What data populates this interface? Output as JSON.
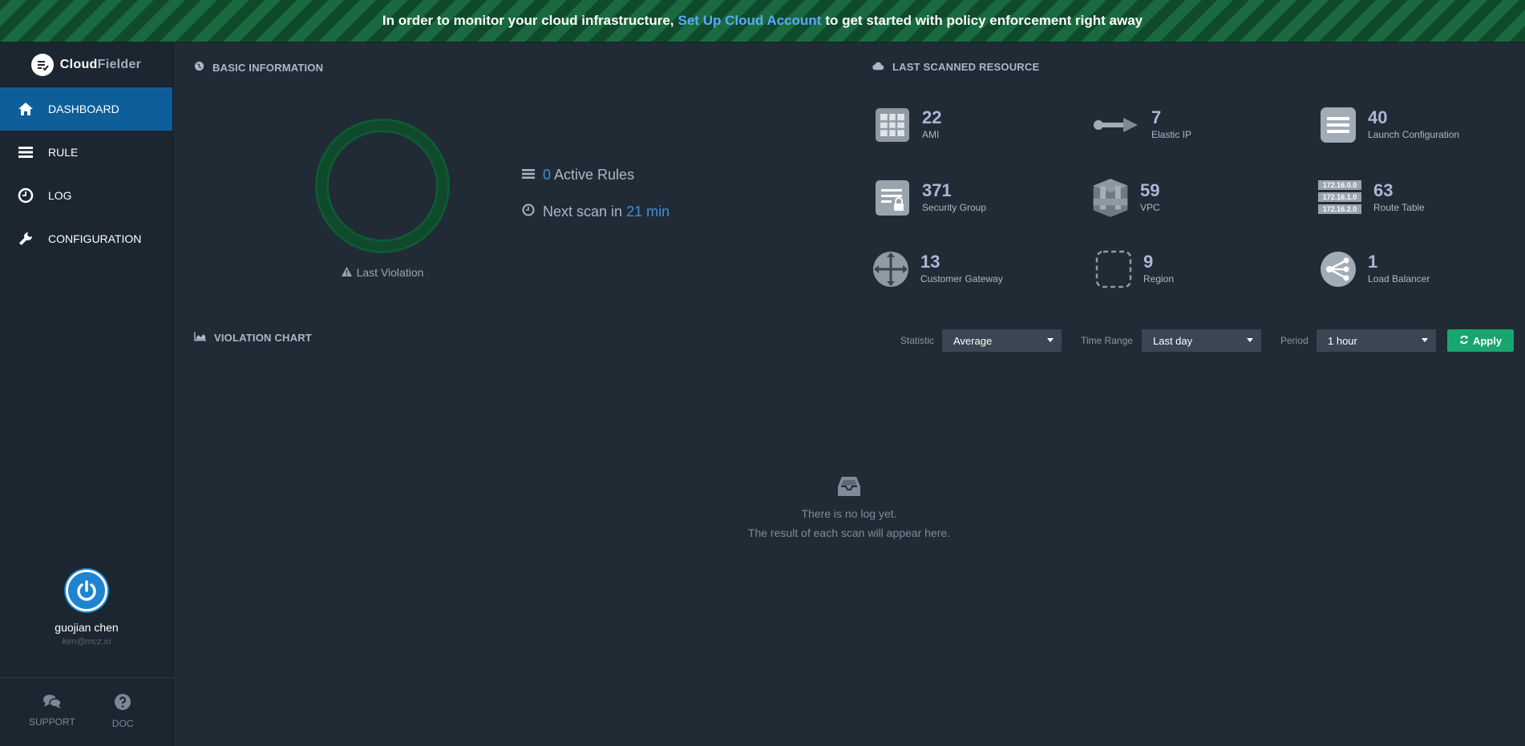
{
  "banner": {
    "prefix": "In order to monitor your cloud infrastructure,",
    "link": "Set Up Cloud Account",
    "suffix": "to get started with policy enforcement right away"
  },
  "brand": {
    "name_part1": "Cloud",
    "name_part2": "Fielder"
  },
  "sidebar": {
    "items": [
      {
        "label": "DASHBOARD",
        "icon": "home-icon",
        "active": true
      },
      {
        "label": "RULE",
        "icon": "list-icon",
        "active": false
      },
      {
        "label": "LOG",
        "icon": "clock-icon",
        "active": false
      },
      {
        "label": "CONFIGURATION",
        "icon": "wrench-icon",
        "active": false
      }
    ],
    "user": {
      "name": "guojian chen",
      "email": "ken@mcz.io"
    },
    "bottom": [
      {
        "label": "SUPPORT",
        "icon": "chat-bubbles-icon"
      },
      {
        "label": "DOC",
        "icon": "question-circle-icon"
      }
    ]
  },
  "basic_info": {
    "heading": "BASIC INFORMATION",
    "last_violation": "Last Violation",
    "active_rules_count": "0",
    "active_rules_label": "Active Rules",
    "next_scan_prefix": "Next scan in",
    "next_scan_value": "21 min"
  },
  "resources": {
    "heading": "LAST SCANNED RESOURCE",
    "items": [
      {
        "count": "22",
        "label": "AMI",
        "icon": "ami-grid-icon"
      },
      {
        "count": "7",
        "label": "Elastic IP",
        "icon": "elastic-ip-arrow-icon"
      },
      {
        "count": "40",
        "label": "Launch Configuration",
        "icon": "launch-config-icon"
      },
      {
        "count": "371",
        "label": "Security Group",
        "icon": "security-group-icon"
      },
      {
        "count": "59",
        "label": "VPC",
        "icon": "vpc-icon"
      },
      {
        "count": "63",
        "label": "Route Table",
        "icon": "route-table-icon"
      },
      {
        "count": "13",
        "label": "Customer Gateway",
        "icon": "customer-gateway-icon"
      },
      {
        "count": "9",
        "label": "Region",
        "icon": "region-icon"
      },
      {
        "count": "1",
        "label": "Load Balancer",
        "icon": "load-balancer-icon"
      }
    ],
    "route_table_ips": [
      "172.16.0.0",
      "172.16.1.0",
      "172.16.2.0"
    ]
  },
  "violation_chart": {
    "heading": "VIOLATION CHART",
    "statistic_label": "Statistic",
    "statistic_value": "Average",
    "time_range_label": "Time Range",
    "time_range_value": "Last day",
    "period_label": "Period",
    "period_value": "1 hour",
    "apply_label": "Apply",
    "empty_line1": "There is no log yet.",
    "empty_line2": "The result of each scan will appear here."
  },
  "colors": {
    "accent_blue": "#0e5f99",
    "link_blue": "#3d8fe0",
    "apply_green": "#17a66f",
    "ring_green": "#0e4a2b"
  }
}
